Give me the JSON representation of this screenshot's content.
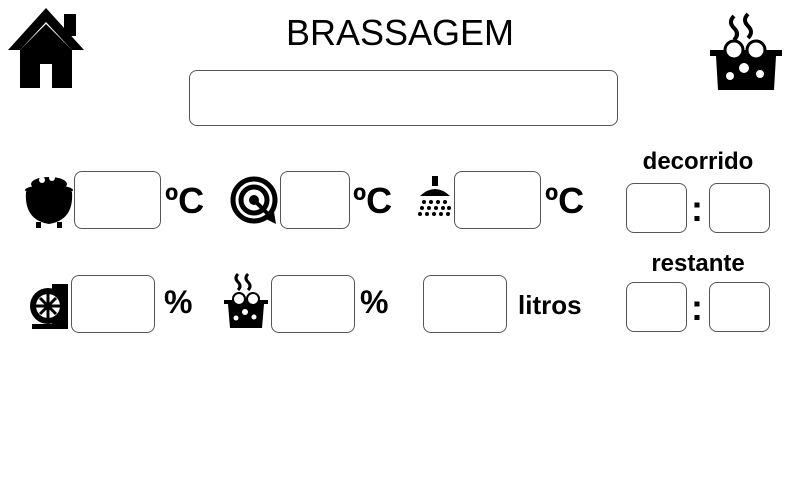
{
  "header": {
    "title": "BRASSAGEM",
    "status_text": "",
    "home_icon": "home-icon",
    "pot_icon": "boiling-pot-icon"
  },
  "row1": {
    "kettle": {
      "icon": "cauldron-icon",
      "value": "",
      "unit": "ºC"
    },
    "target": {
      "icon": "target-icon",
      "value": "",
      "unit": "ºC"
    },
    "sparge": {
      "icon": "shower-icon",
      "value": "",
      "unit": "ºC"
    }
  },
  "row2": {
    "pump": {
      "icon": "pump-icon",
      "value": "",
      "unit": "%"
    },
    "boil": {
      "icon": "boiling-pot-icon",
      "value": "",
      "unit": "%"
    },
    "volume": {
      "value": "",
      "unit": "litros"
    }
  },
  "timers": {
    "elapsed": {
      "label": "decorrido",
      "hours": "",
      "minutes": "",
      "separator": ":"
    },
    "remaining": {
      "label": "restante",
      "hours": "",
      "minutes": "",
      "separator": ":"
    }
  }
}
